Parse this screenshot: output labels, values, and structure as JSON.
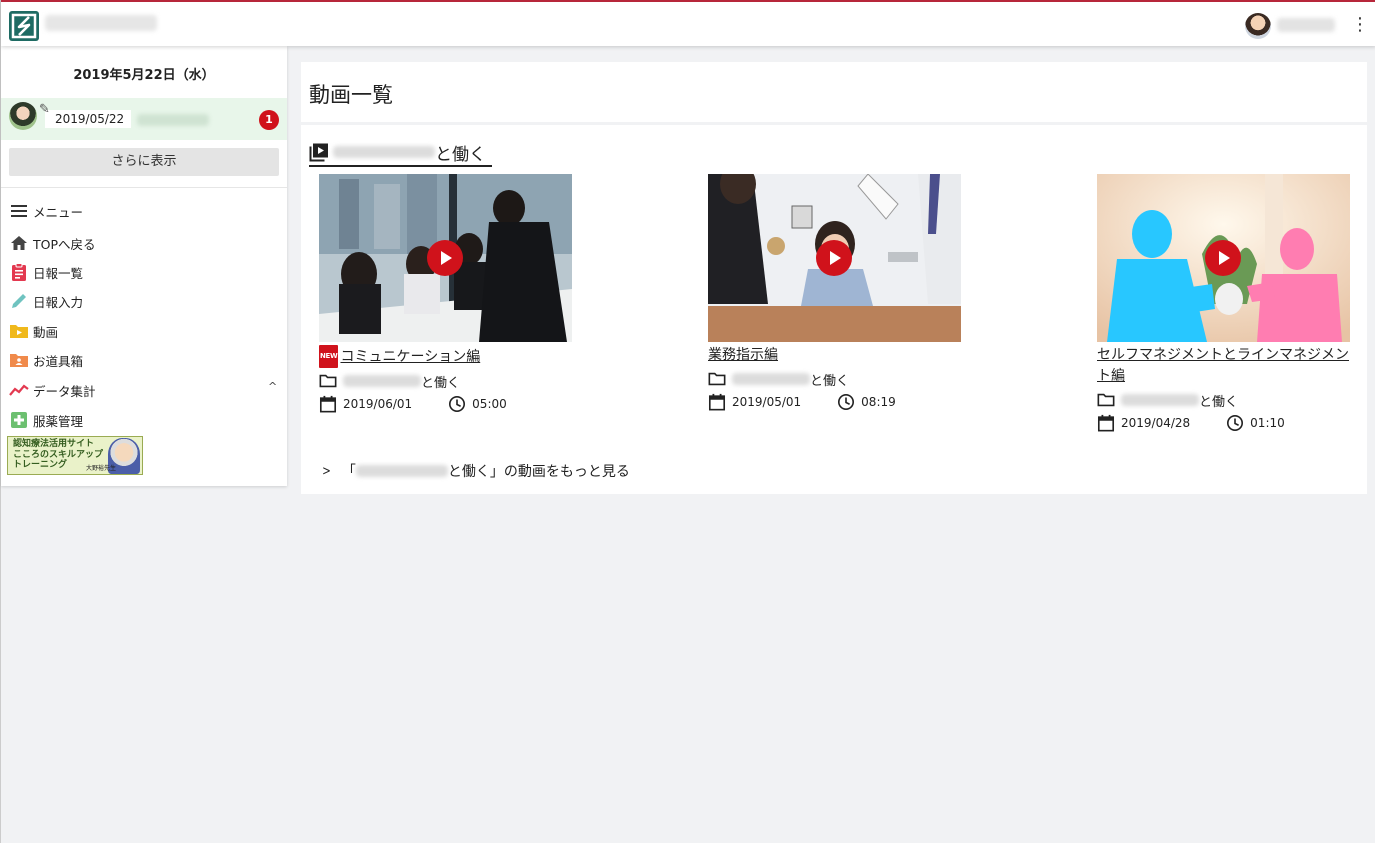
{
  "header": {
    "logo_icon": "brand-logo-icon",
    "menu_icon": "kebab-menu-icon",
    "accent": "#b7263a"
  },
  "sidebar": {
    "date_heading": "2019年5月22日（水）",
    "report": {
      "date": "2019/05/22",
      "badge": "1",
      "avatar_icon": "user-avatar",
      "edit_icon": "pencil-icon"
    },
    "show_more": "さらに表示",
    "menu": [
      {
        "label": "メニュー",
        "icon": "hamburger-icon"
      },
      {
        "label": "TOPへ戻る",
        "icon": "home-icon"
      },
      {
        "label": "日報一覧",
        "icon": "clipboard-icon"
      },
      {
        "label": "日報入力",
        "icon": "pencil-icon"
      },
      {
        "label": "動画",
        "icon": "video-folder-icon"
      },
      {
        "label": "お道具箱",
        "icon": "toolbox-folder-icon"
      },
      {
        "label": "データ集計",
        "icon": "trend-chart-icon"
      },
      {
        "label": "服薬管理",
        "icon": "medical-plus-icon"
      }
    ],
    "collapse_caret": "^",
    "banner": {
      "lines": [
        "認知療法活用サイト",
        "こころのスキルアップ",
        "トレーニング"
      ],
      "caption": "大野裕先生"
    }
  },
  "main": {
    "title": "動画一覧",
    "section": {
      "suffix": "と働く",
      "icon": "video-library-icon"
    },
    "new_badge": "NEW",
    "videos": [
      {
        "title": "コミュニケーション編",
        "is_new": true,
        "category_suffix": "と働く",
        "date": "2019/06/01",
        "duration": "05:00"
      },
      {
        "title": "業務指示編",
        "is_new": false,
        "category_suffix": "と働く",
        "date": "2019/05/01",
        "duration": "08:19"
      },
      {
        "title": "セルフマネジメントとラインマネジメント編",
        "is_new": false,
        "category_suffix": "と働く",
        "date": "2019/04/28",
        "duration": "01:10"
      }
    ],
    "more_link": {
      "prefix": "「",
      "suffix": "と働く」の動画をもっと見る"
    }
  },
  "colors": {
    "badge_red": "#d0121b",
    "report_bg": "#e8f6ea",
    "page_bg": "#f1f2f4"
  }
}
